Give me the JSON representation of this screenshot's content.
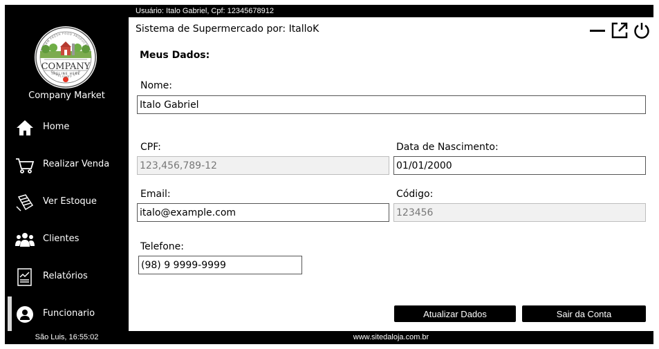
{
  "topbar": {
    "user_info": "Usuário: Italo Gabriel, Cpf: 12345678912"
  },
  "sidebar": {
    "logo": {
      "name": "COMPANY",
      "tagline": "TAGLINE HERE",
      "established": "ESTABLISHED 2010",
      "ring_text": "FARM FRESH FOOD PRODUCTS"
    },
    "company_name": "Company Market",
    "items": [
      {
        "label": "Home",
        "icon": "home-icon"
      },
      {
        "label": "Realizar Venda",
        "icon": "cart-icon"
      },
      {
        "label": "Ver Estoque",
        "icon": "stock-icon"
      },
      {
        "label": "Clientes",
        "icon": "users-icon"
      },
      {
        "label": "Relatórios",
        "icon": "report-icon"
      },
      {
        "label": "Funcionario",
        "icon": "user-icon"
      }
    ],
    "clock": "São Luis, 16:55:02"
  },
  "main": {
    "title": "Sistema de Supermercado por: ItalloK",
    "section": "Meus Dados:",
    "nome": {
      "label": "Nome:",
      "value": "Italo Gabriel"
    },
    "cpf": {
      "label": "CPF:",
      "value": "123,456,789-12"
    },
    "nascimento": {
      "label": "Data de Nascimento:",
      "value": "01/01/2000"
    },
    "email": {
      "label": "Email:",
      "value": "italo@example.com"
    },
    "codigo": {
      "label": "Código:",
      "value": "123456"
    },
    "telefone": {
      "label": "Telefone:",
      "value": "(98) 9 9999-9999"
    },
    "update_button": "Atualizar Dados",
    "logout_button": "Sair da Conta"
  },
  "footer": {
    "site": "www.sitedaloja.com.br"
  },
  "colors": {
    "background": "#000000",
    "accent": "#ffffff",
    "readonly_field": "#f1f1f1"
  }
}
